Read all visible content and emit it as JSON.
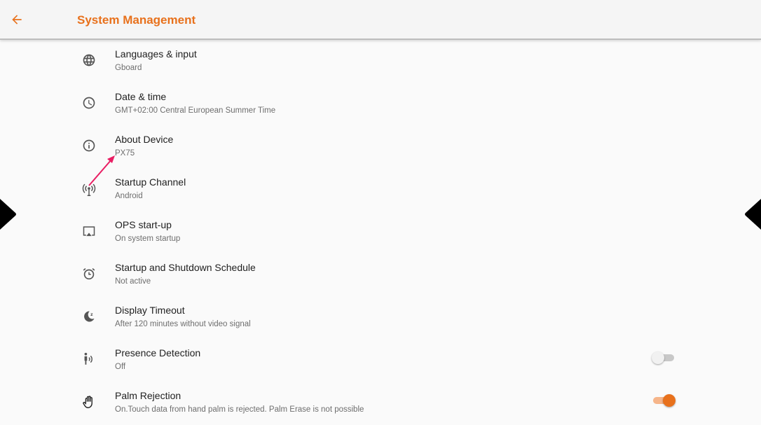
{
  "header": {
    "title": "System Management",
    "back_icon": "arrow-left-icon",
    "accent_color": "#e8711c"
  },
  "settings": [
    {
      "label": "Languages & input",
      "summary": "Gboard",
      "icon": "globe-icon"
    },
    {
      "label": "Date & time",
      "summary": "GMT+02:00 Central European Summer Time",
      "icon": "clock-icon"
    },
    {
      "label": "About Device",
      "summary": "PX75",
      "icon": "info-icon"
    },
    {
      "label": "Startup Channel",
      "summary": "Android",
      "icon": "broadcast-icon"
    },
    {
      "label": "OPS start-up",
      "summary": "On system startup",
      "icon": "cast-screen-icon"
    },
    {
      "label": "Startup and Shutdown Schedule",
      "summary": "Not active",
      "icon": "alarm-clock-icon"
    },
    {
      "label": "Display Timeout",
      "summary": "After 120 minutes without video signal",
      "icon": "sleep-moon-icon"
    },
    {
      "label": "Presence Detection",
      "summary": "Off",
      "icon": "person-sensing-icon",
      "toggle": "off"
    },
    {
      "label": "Palm Rejection",
      "summary": "On.Touch data from hand palm is rejected. Palm Erase is not possible",
      "icon": "hand-icon",
      "toggle": "on"
    }
  ],
  "side_handles": [
    "left-handle-icon",
    "right-handle-icon"
  ],
  "annotation_color": "#e91e63"
}
